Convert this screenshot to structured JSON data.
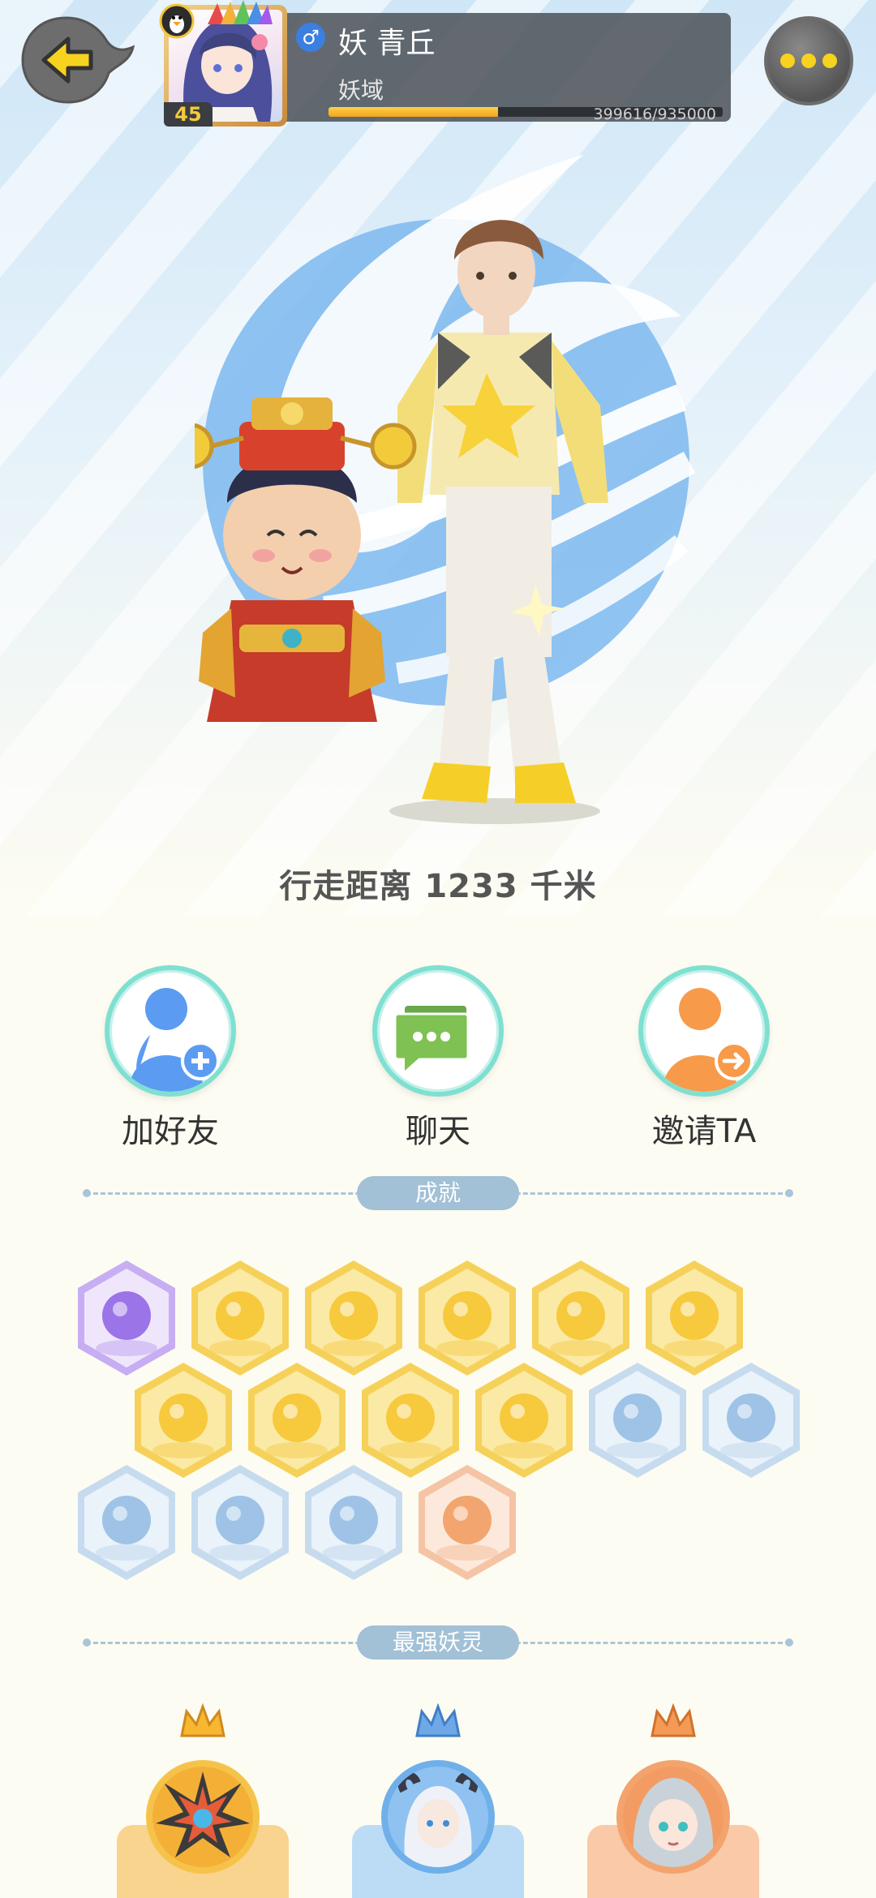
{
  "header": {
    "player_name": "妖 青丘",
    "region": "妖域",
    "gender_icon": "♂",
    "level": "45",
    "xp_text": "399616/935000",
    "xp_progress": 0.43
  },
  "distance_text": "行走距离 1233 千米",
  "actions": [
    {
      "label": "加好友",
      "icon": "add-friend-icon"
    },
    {
      "label": "聊天",
      "icon": "chat-icon"
    },
    {
      "label": "邀请TA",
      "icon": "invite-icon"
    }
  ],
  "sections": {
    "achievements_title": "成就",
    "strongest_title": "最强妖灵"
  },
  "achievements": [
    {
      "name": "devil-badge",
      "tone": "purple"
    },
    {
      "name": "sneaker-badge",
      "tone": "gold"
    },
    {
      "name": "moon-badge",
      "tone": "gold"
    },
    {
      "name": "helmet-badge",
      "tone": "gold"
    },
    {
      "name": "egg-badge",
      "tone": "gold"
    },
    {
      "name": "yinyang-swirl-badge",
      "tone": "gold"
    },
    {
      "name": "yinyang-book-badge",
      "tone": "gold"
    },
    {
      "name": "goldfish-badge",
      "tone": "gold"
    },
    {
      "name": "cat-badge",
      "tone": "gold"
    },
    {
      "name": "fox-book-badge",
      "tone": "gold"
    },
    {
      "name": "orb-badge",
      "tone": "blue"
    },
    {
      "name": "monkey-badge",
      "tone": "blue"
    },
    {
      "name": "kitten-badge",
      "tone": "blue"
    },
    {
      "name": "scroll-badge",
      "tone": "blue"
    },
    {
      "name": "monster-badge",
      "tone": "blue"
    },
    {
      "name": "stroller-badge",
      "tone": "orange"
    }
  ],
  "colors": {
    "gold": "#f7c93c",
    "blue": "#cfe2f3",
    "purple": "#b596f0",
    "orange": "#f6b38c",
    "accent_teal": "#7fe0d1"
  }
}
